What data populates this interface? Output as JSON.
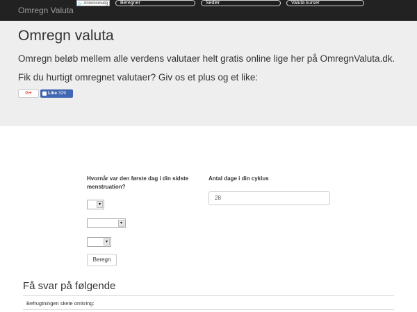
{
  "navbar": {
    "brand": "Omregn Valuta",
    "adchoices_label": "Annoncevalg",
    "items": [
      "Beregner",
      "Sedler",
      "Valuta kurser"
    ]
  },
  "jumbotron": {
    "title": "Omregn valuta",
    "lead": "Omregn beløb mellem alle verdens valutaer helt gratis online lige her på OmregnValuta.dk.",
    "share_prompt": "Fik du hurtigt omregnet valutaer? Giv os et plus og et like:",
    "gplus_label": "G+",
    "fb_like_label": "Like",
    "fb_like_count": "329"
  },
  "form": {
    "first_day_label": "Hvornår var den første dag i din sidste menstruation?",
    "cycle_label": "Antal dage i din cyklus",
    "cycle_value": "28",
    "day_select": "",
    "month_select": "",
    "year_select": "",
    "submit_label": "Beregn"
  },
  "results": {
    "title": "Få svar på følgende",
    "rows": [
      "Befrugtningen skete omkring:"
    ]
  },
  "colors": {
    "navbar_bg": "#222222",
    "jumbotron_bg": "#eeeeee",
    "facebook_blue": "#4267b2"
  }
}
